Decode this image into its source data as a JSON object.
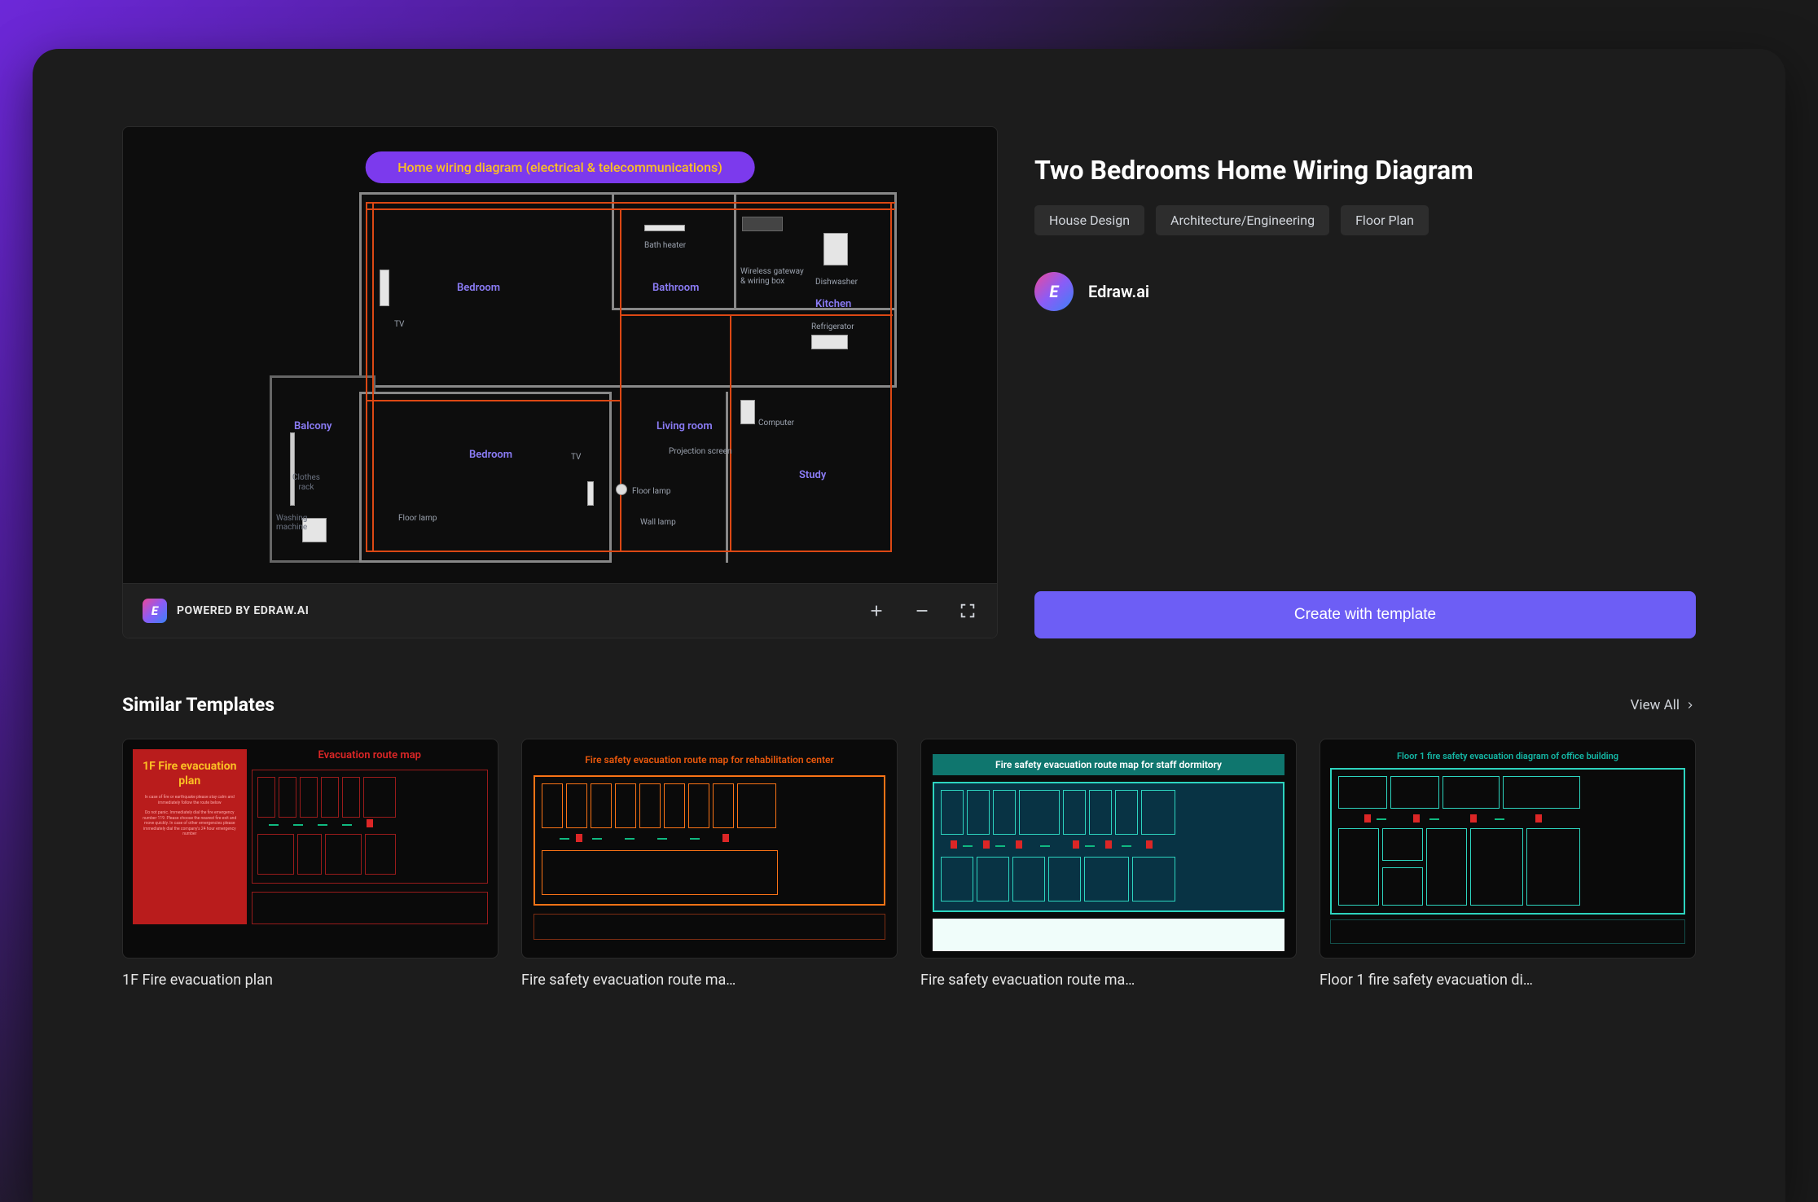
{
  "template": {
    "title": "Two Bedrooms Home Wiring Diagram",
    "tags": [
      "House Design",
      "Architecture/Engineering",
      "Floor Plan"
    ],
    "author": "Edraw.ai",
    "cta_label": "Create with template"
  },
  "preview": {
    "diagram_title": "Home wiring diagram (electrical & telecommunications)",
    "rooms": {
      "bedroom1": "Bedroom",
      "bedroom2": "Bedroom",
      "bathroom": "Bathroom",
      "kitchen": "Kitchen",
      "living": "Living room",
      "study": "Study",
      "balcony": "Balcony"
    },
    "devices": {
      "bath_heater": "Bath heater",
      "wireless_gateway": "Wireless gateway & wiring box",
      "dishwasher": "Dishwasher",
      "refrigerator": "Refrigerator",
      "computer": "Computer",
      "projection_screen": "Projection screen",
      "floor_lamp1": "Floor lamp",
      "floor_lamp2": "Floor lamp",
      "wall_lamp": "Wall lamp",
      "tv1": "TV",
      "tv2": "TV",
      "clothes_rack": "Clothes rack",
      "washing_machine": "Washing machine"
    },
    "powered_by": "POWERED BY EDRAW.AI"
  },
  "similar": {
    "heading": "Similar Templates",
    "view_all": "View All",
    "items": [
      {
        "caption": "1F Fire evacuation plan",
        "thumb_title": "1F Fire evacuation plan",
        "thumb_subtitle": "Evacuation route map"
      },
      {
        "caption": "Fire safety evacuation route ma…",
        "thumb_title": "Fire safety evacuation route map for rehabilitation center"
      },
      {
        "caption": "Fire safety evacuation route ma…",
        "thumb_title": "Fire safety evacuation route map for staff dormitory"
      },
      {
        "caption": "Floor 1 fire safety evacuation di…",
        "thumb_title": "Floor 1 fire safety evacuation diagram of office building"
      }
    ]
  }
}
